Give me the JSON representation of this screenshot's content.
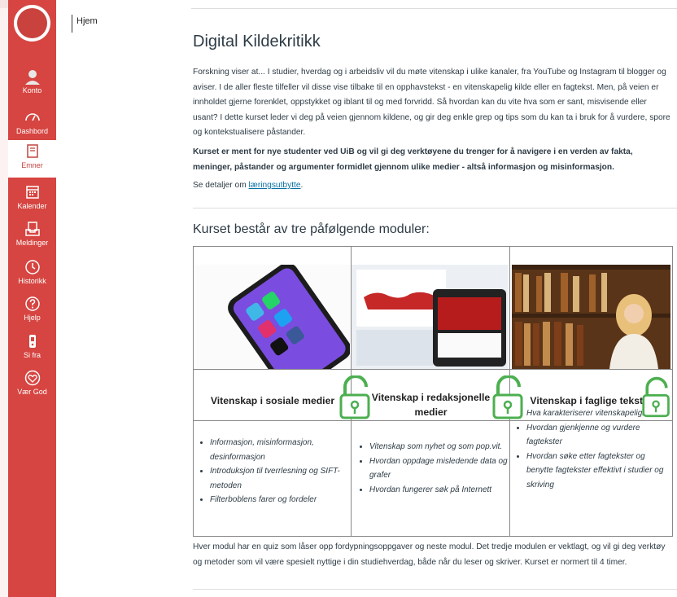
{
  "nav": {
    "items": [
      {
        "label": "Konto",
        "icon": "user-icon"
      },
      {
        "label": "Dashbord",
        "icon": "dashboard-icon"
      },
      {
        "label": "Emner",
        "icon": "book-icon"
      },
      {
        "label": "Kalender",
        "icon": "calendar-icon"
      },
      {
        "label": "Meldinger",
        "icon": "inbox-icon"
      },
      {
        "label": "Historikk",
        "icon": "clock-icon"
      },
      {
        "label": "Hjelp",
        "icon": "help-icon"
      },
      {
        "label": "Si fra",
        "icon": "report-icon"
      },
      {
        "label": "Vær God",
        "icon": "heart-icon"
      }
    ],
    "active_index": 2,
    "brand_color": "#d64541"
  },
  "breadcrumb": {
    "label": "Hjem"
  },
  "page": {
    "title": "Digital Kildekritikk",
    "intro": "Forskning viser at... I studier, hverdag og i arbeidsliv vil du møte vitenskap i ulike kanaler, fra YouTube og Instagram til blogger og aviser. I de aller fleste tilfeller vil disse vise tilbake til en opphavstekst - en vitenskapelig kilde eller en fagtekst. Men, på veien er innholdet gjerne forenklet, oppstykket og iblant til og med forvridd. Så hvordan kan du vite hva som er sant, misvisende eller usant? I dette kurset leder vi deg på veien gjennom kildene, og gir deg enkle grep og tips som du kan ta i bruk for å vurdere, spore og kontekstualisere påstander.",
    "bold_text": "Kurset er ment for nye studenter ved UiB og vil gi deg verktøyene du trenger for å navigere i en verden av fakta, meninger, påstander og argumenter formidlet gjennom ulike medier - altså informasjon og misinformasjon.",
    "details_prefix": "Se detaljer om ",
    "details_link": "læringsutbytte",
    "details_suffix": ".",
    "modules_heading": "Kurset består av tre påfølgende moduler:",
    "modules": [
      {
        "title": "Vitenskap i sosiale medier",
        "image": "smartphone-social-apps-image",
        "bullets": [
          "Informasjon, misinformasjon, desinformasjon",
          "Introduksjon til tverrlesning og SIFT-metoden",
          "Filterboblens farer og fordeler"
        ]
      },
      {
        "title": "Vitenskap i redaksjonelle medier",
        "image": "news-coronavirus-image",
        "bullets": [
          "Vitenskap som nyhet og som pop.vit.",
          "Hvordan oppdage misledende data og grafer",
          "Hvordan fungerer søk på Internett"
        ]
      },
      {
        "title": "Vitenskap i faglige tekster",
        "image": "library-bookshelf-image",
        "bullets": [
          "Hva karakteriserer vitenskapelighet",
          "Hvordan gjenkjenne og vurdere fagtekster",
          "Hvordan søke etter fagtekster og benytte fagtekster effektivt i studier og skriving"
        ]
      }
    ],
    "outro": "Hver modul har en quiz som låser opp fordypningsoppgaver og neste modul. Det tredje modulen er vektlagt, og vil gi deg verktøy og metoder som vil være spesielt nyttige i din studiehverdag, både når du leser og skriver. Kurset er normert til 4 timer.",
    "lock_color": "#4caf50"
  }
}
